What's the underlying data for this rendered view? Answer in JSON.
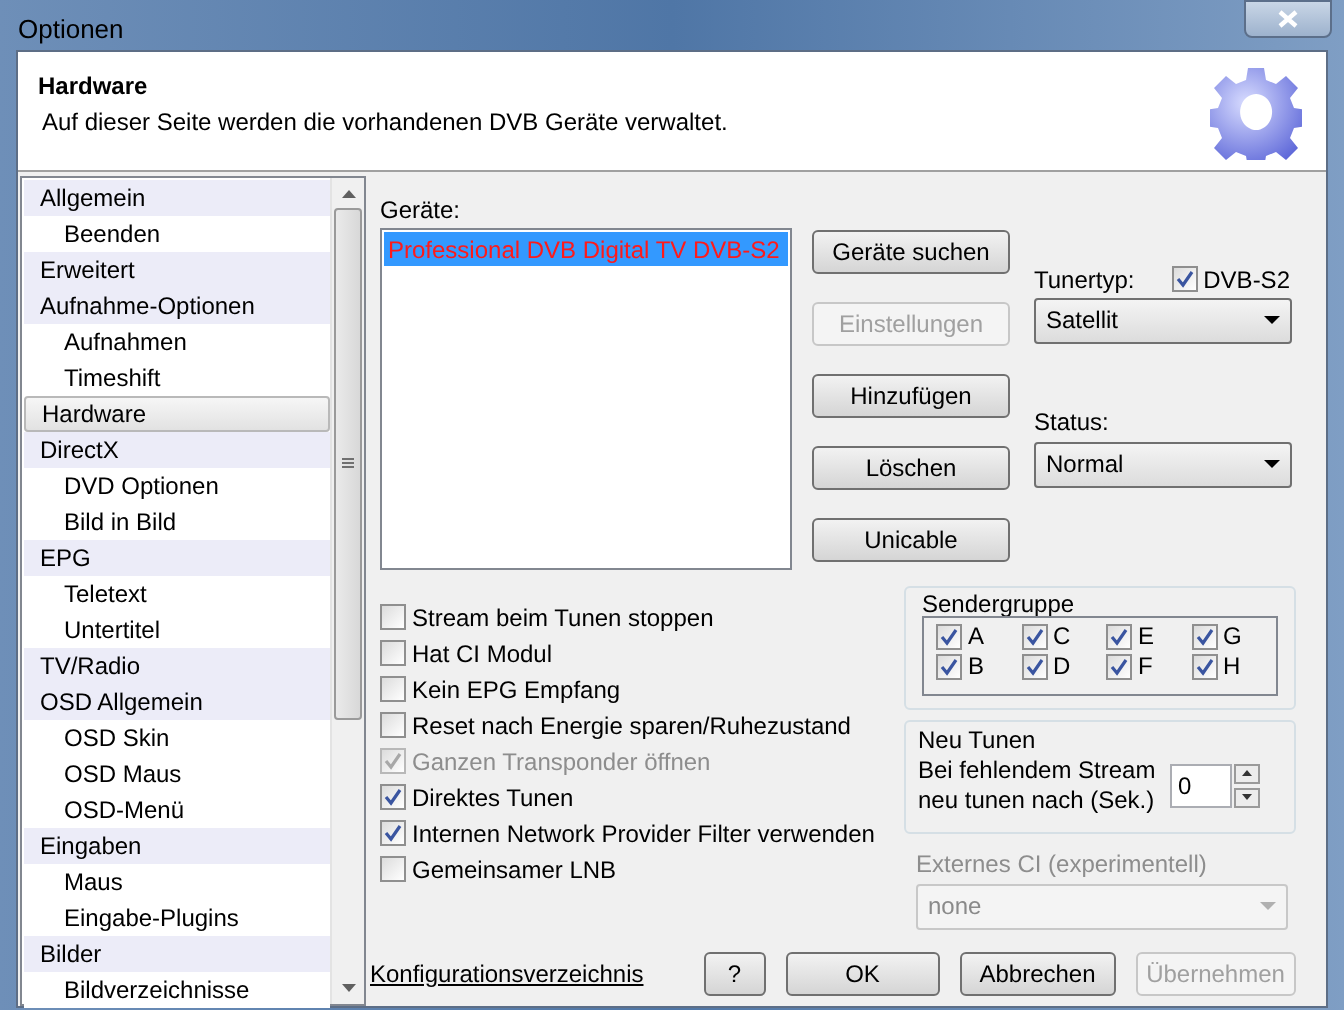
{
  "window": {
    "title": "Optionen"
  },
  "header": {
    "title": "Hardware",
    "description": "Auf dieser Seite werden die vorhandenen DVB Geräte verwaltet."
  },
  "sidebar": {
    "items": [
      {
        "label": "Allgemein",
        "selected": false,
        "children": [
          {
            "label": "Beenden",
            "selected": false
          }
        ]
      },
      {
        "label": "Erweitert",
        "selected": false
      },
      {
        "label": "Aufnahme-Optionen",
        "selected": false,
        "children": [
          {
            "label": "Aufnahmen",
            "selected": false
          },
          {
            "label": "Timeshift",
            "selected": false
          }
        ]
      },
      {
        "label": "Hardware",
        "selected": true
      },
      {
        "label": "DirectX",
        "selected": false,
        "children": [
          {
            "label": "DVD Optionen",
            "selected": false
          },
          {
            "label": "Bild in Bild",
            "selected": false
          }
        ]
      },
      {
        "label": "EPG",
        "selected": false,
        "children": [
          {
            "label": "Teletext",
            "selected": false
          },
          {
            "label": "Untertitel",
            "selected": false
          }
        ]
      },
      {
        "label": "TV/Radio",
        "selected": false
      },
      {
        "label": "OSD Allgemein",
        "selected": false,
        "children": [
          {
            "label": "OSD Skin",
            "selected": false
          },
          {
            "label": "OSD Maus",
            "selected": false
          },
          {
            "label": "OSD-Menü",
            "selected": false
          }
        ]
      },
      {
        "label": "Eingaben",
        "selected": false,
        "children": [
          {
            "label": "Maus",
            "selected": false
          },
          {
            "label": "Eingabe-Plugins",
            "selected": false
          }
        ]
      },
      {
        "label": "Bilder",
        "selected": false,
        "children": [
          {
            "label": "Bildverzeichnisse",
            "selected": false
          }
        ]
      }
    ]
  },
  "devices": {
    "label": "Geräte:",
    "items": [
      {
        "label": "Professional DVB Digital TV DVB-S2",
        "selected": true
      }
    ]
  },
  "device_buttons": [
    {
      "label": "Geräte suchen",
      "disabled": false
    },
    {
      "label": "Einstellungen",
      "disabled": true
    },
    {
      "label": "Hinzufügen",
      "disabled": false
    },
    {
      "label": "Löschen",
      "disabled": false
    },
    {
      "label": "Unicable",
      "disabled": false
    }
  ],
  "tuner_type": {
    "label": "Tunertyp:",
    "dvb_s2": {
      "label": "DVB-S2",
      "checked": true
    },
    "value": "Satellit"
  },
  "status": {
    "label": "Status:",
    "value": "Normal"
  },
  "options": [
    {
      "label": "Stream beim Tunen stoppen",
      "checked": false,
      "disabled": false
    },
    {
      "label": "Hat CI Modul",
      "checked": false,
      "disabled": false
    },
    {
      "label": "Kein EPG Empfang",
      "checked": false,
      "disabled": false
    },
    {
      "label": "Reset nach Energie sparen/Ruhezustand",
      "checked": false,
      "disabled": false
    },
    {
      "label": "Ganzen Transponder öffnen",
      "checked": true,
      "disabled": true
    },
    {
      "label": "Direktes Tunen",
      "checked": true,
      "disabled": false
    },
    {
      "label": "Internen Network Provider Filter verwenden",
      "checked": true,
      "disabled": false
    },
    {
      "label": "Gemeinsamer LNB",
      "checked": false,
      "disabled": false
    }
  ],
  "sender_group": {
    "title": "Sendergruppe",
    "items": [
      {
        "label": "A",
        "checked": true
      },
      {
        "label": "C",
        "checked": true
      },
      {
        "label": "E",
        "checked": true
      },
      {
        "label": "G",
        "checked": true
      },
      {
        "label": "B",
        "checked": true
      },
      {
        "label": "D",
        "checked": true
      },
      {
        "label": "F",
        "checked": true
      },
      {
        "label": "H",
        "checked": true
      }
    ]
  },
  "retune": {
    "title": "Neu Tunen",
    "label": "Bei fehlendem Stream neu tunen nach (Sek.)",
    "value": "0"
  },
  "external_ci": {
    "label": "Externes CI (experimentell)",
    "value": "none",
    "disabled": true
  },
  "footer": {
    "link": "Konfigurationsverzeichnis",
    "buttons": [
      {
        "label": "?",
        "disabled": false
      },
      {
        "label": "OK",
        "disabled": false
      },
      {
        "label": "Abbrechen",
        "disabled": false
      },
      {
        "label": "Übernehmen",
        "disabled": true
      }
    ]
  }
}
